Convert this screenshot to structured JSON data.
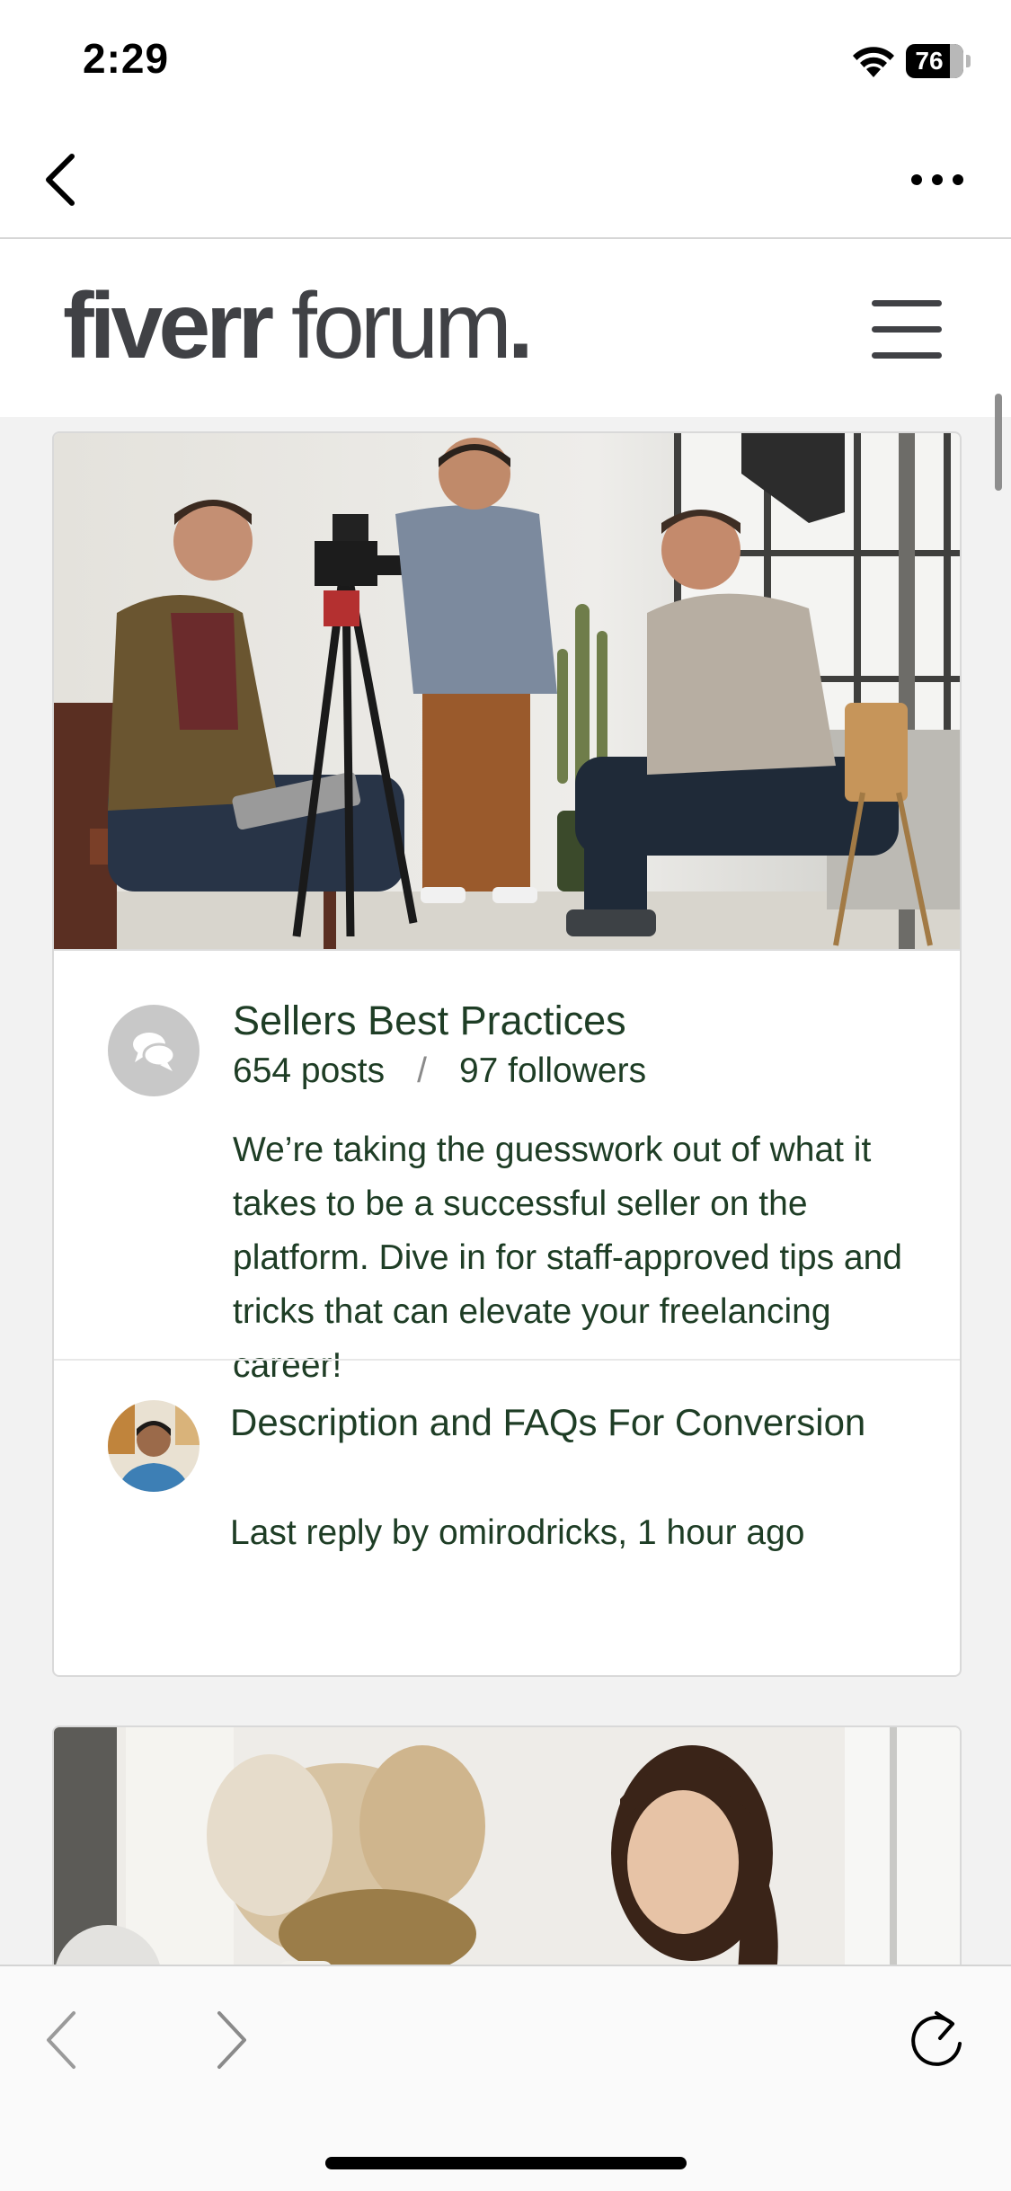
{
  "status_bar": {
    "time": "2:29",
    "battery_level": "76",
    "battery_fraction": 0.76,
    "icons": [
      "wifi-icon",
      "battery-icon"
    ]
  },
  "browser_nav": {
    "back_icon": "chevron-left-icon",
    "more_icon": "ellipsis-icon"
  },
  "site_header": {
    "logo_bold": "fiverr",
    "logo_light": " forum",
    "logo_dot": ".",
    "menu_icon": "hamburger-menu-icon"
  },
  "category": {
    "title": "Sellers Best Practices",
    "posts": "654 posts",
    "separator": "/",
    "followers": "97 followers",
    "description": "We’re taking the guesswork out of what it takes to be a successful seller on the platform. Dive in for staff-approved tips and tricks that can elevate your freelancing career!",
    "icon": "chat-bubbles-icon",
    "latest_topic": {
      "title": "Description and FAQs For Conversion",
      "meta": "Last reply by omirodricks, 1 hour ago"
    }
  },
  "bottom_toolbar": {
    "back_icon": "chevron-left-icon",
    "forward_icon": "chevron-right-icon",
    "reload_icon": "reload-icon"
  },
  "colors": {
    "accent_text": "#1e3d25",
    "logo": "#404145",
    "background": "#f2f2f2"
  }
}
